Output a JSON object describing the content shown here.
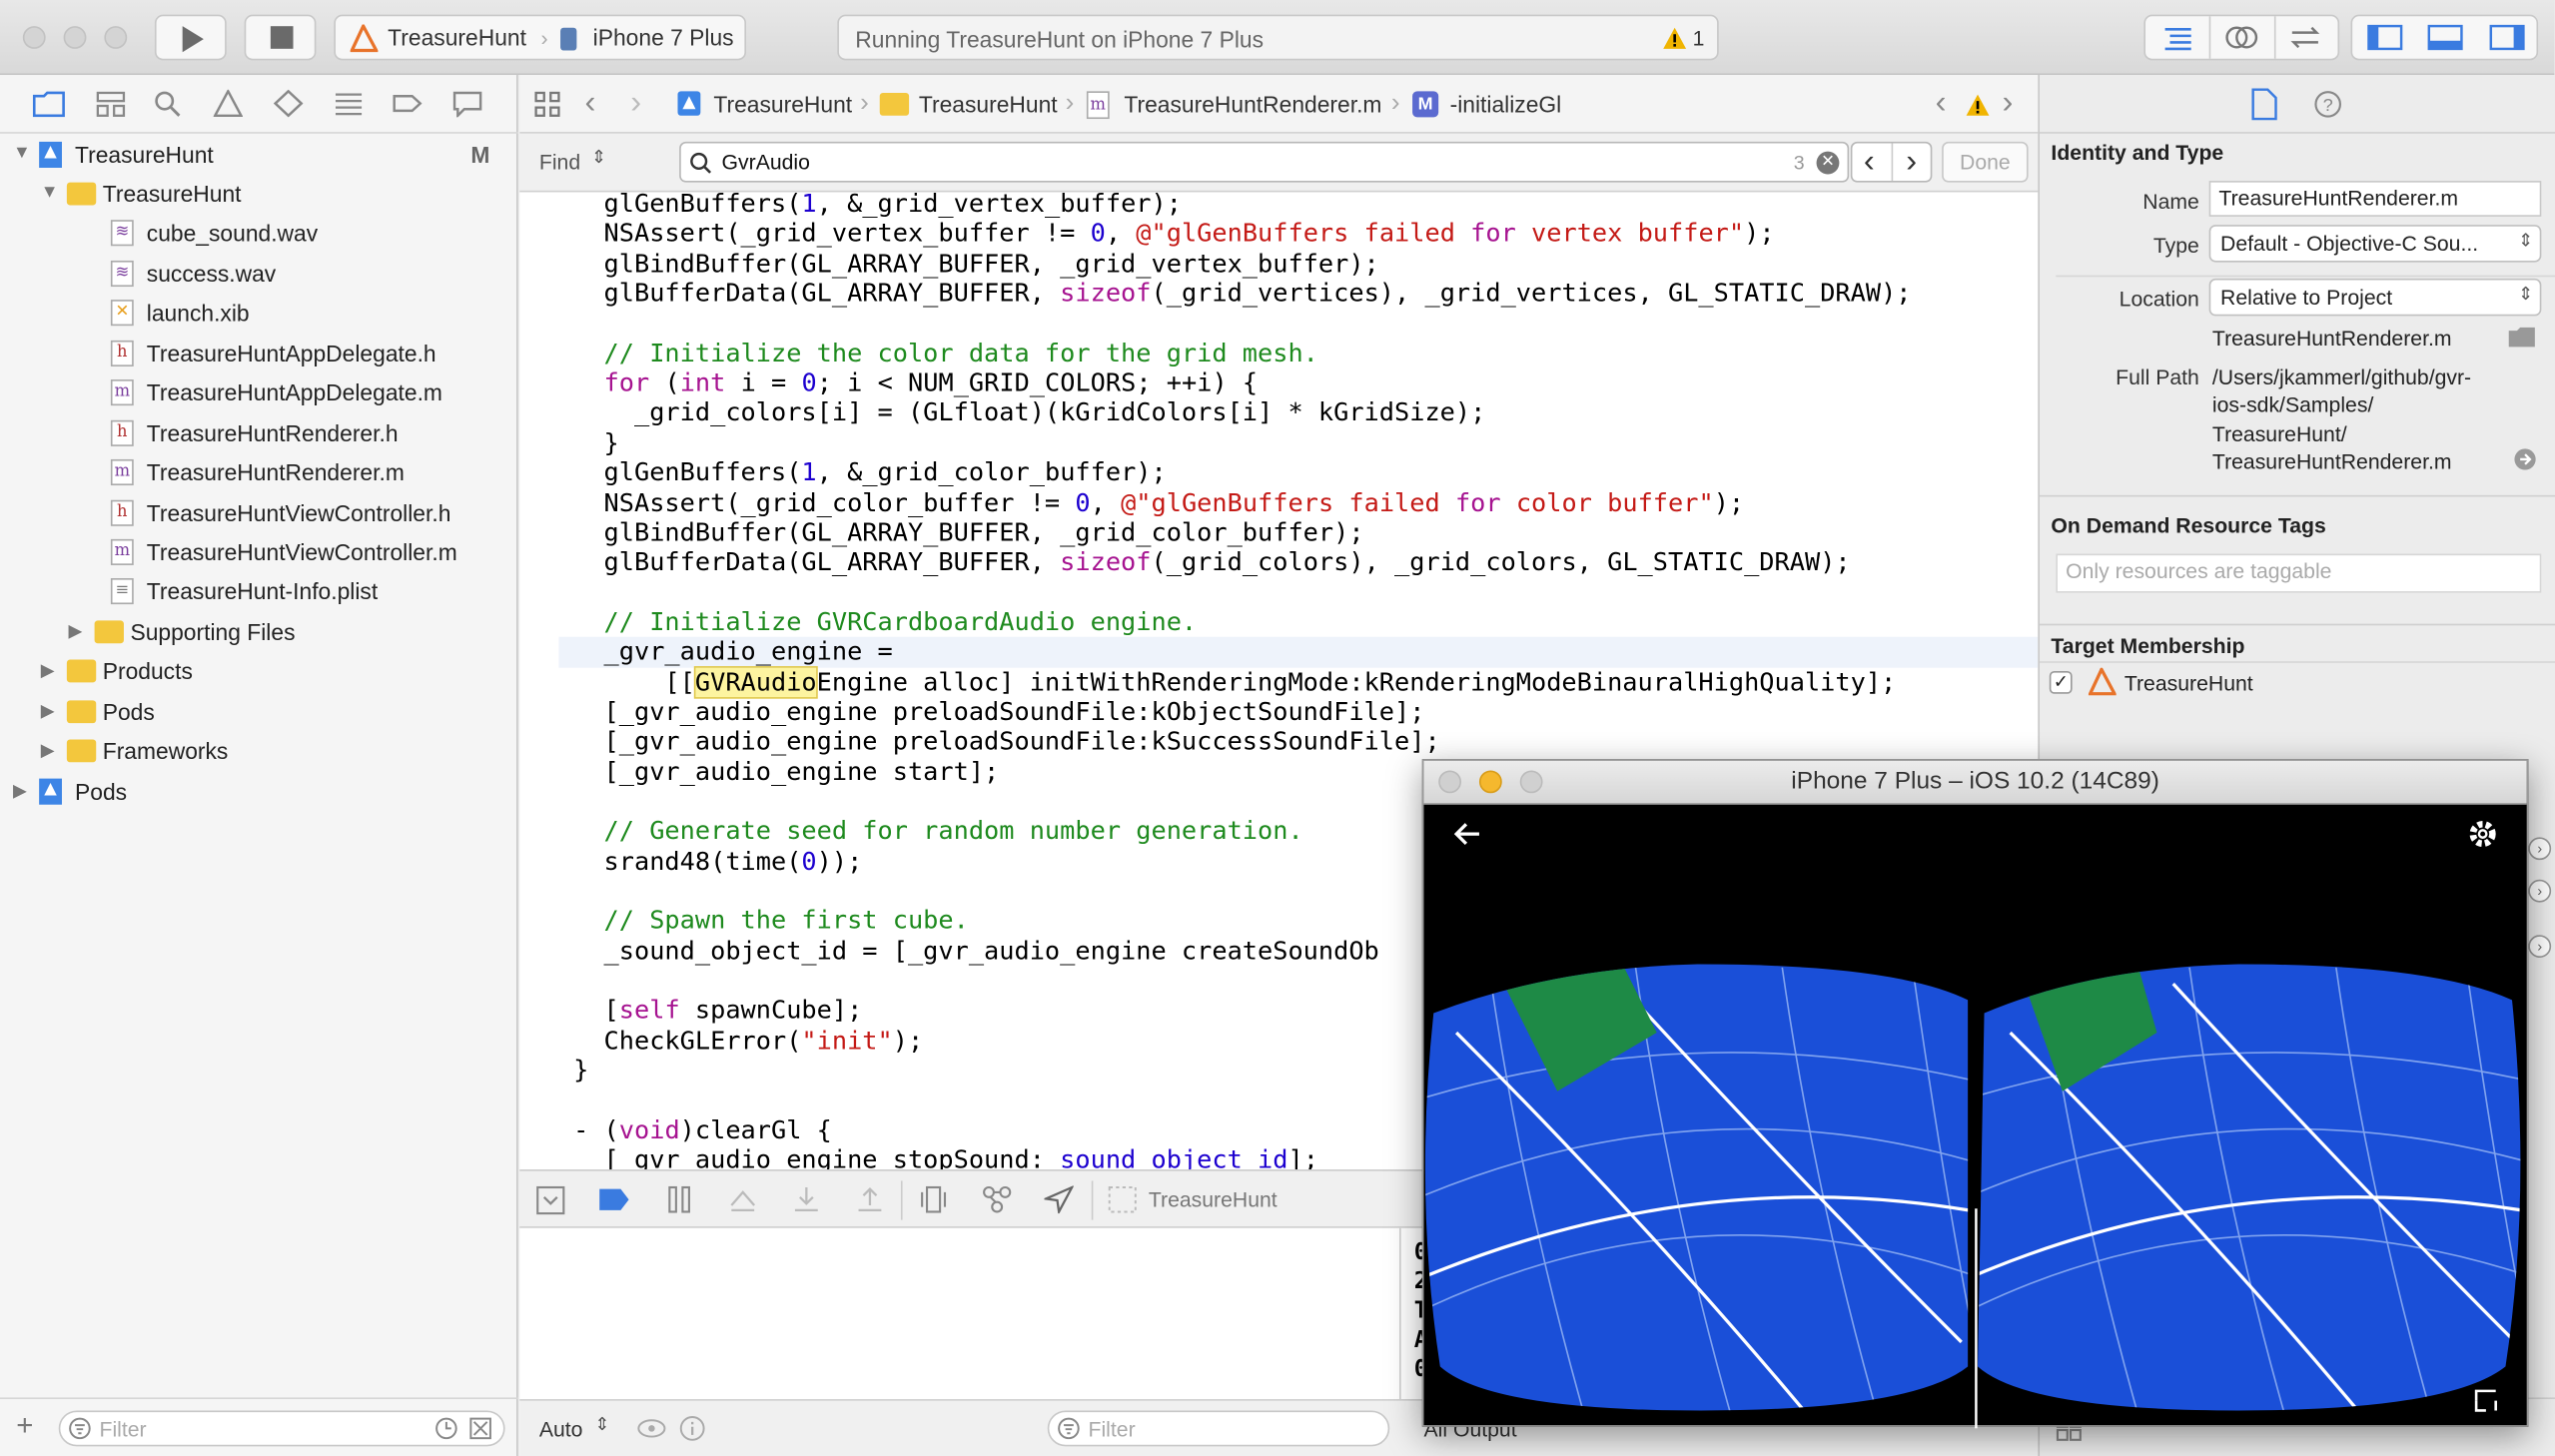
{
  "toolbar": {
    "scheme": "TreasureHunt",
    "device": "iPhone 7 Plus",
    "status": "Running TreasureHunt on iPhone 7 Plus",
    "warning_count": "1"
  },
  "navigator": {
    "items": [
      {
        "label": "TreasureHunt",
        "badge": "M"
      },
      {
        "label": "TreasureHunt"
      },
      {
        "label": "cube_sound.wav"
      },
      {
        "label": "success.wav"
      },
      {
        "label": "launch.xib"
      },
      {
        "label": "TreasureHuntAppDelegate.h"
      },
      {
        "label": "TreasureHuntAppDelegate.m"
      },
      {
        "label": "TreasureHuntRenderer.h"
      },
      {
        "label": "TreasureHuntRenderer.m"
      },
      {
        "label": "TreasureHuntViewController.h"
      },
      {
        "label": "TreasureHuntViewController.m"
      },
      {
        "label": "TreasureHunt-Info.plist"
      },
      {
        "label": "Supporting Files"
      },
      {
        "label": "Products"
      },
      {
        "label": "Pods"
      },
      {
        "label": "Frameworks"
      },
      {
        "label": "Pods"
      }
    ],
    "filter_placeholder": "Filter"
  },
  "jumpbar": {
    "crumbs": [
      "TreasureHunt",
      "TreasureHunt",
      "TreasureHuntRenderer.m",
      "-initializeGl"
    ]
  },
  "find": {
    "mode": "Find",
    "query": "GvrAudio",
    "count": "3",
    "done": "Done"
  },
  "code_lines": [
    "  glGenBuffers(1, &_grid_vertex_buffer);",
    "  NSAssert(_grid_vertex_buffer != 0, @\"glGenBuffers failed for vertex buffer\");",
    "  glBindBuffer(GL_ARRAY_BUFFER, _grid_vertex_buffer);",
    "  glBufferData(GL_ARRAY_BUFFER, sizeof(_grid_vertices), _grid_vertices, GL_STATIC_DRAW);",
    "",
    "  // Initialize the color data for the grid mesh.",
    "  for (int i = 0; i < NUM_GRID_COLORS; ++i) {",
    "    _grid_colors[i] = (GLfloat)(kGridColors[i] * kGridSize);",
    "  }",
    "  glGenBuffers(1, &_grid_color_buffer);",
    "  NSAssert(_grid_color_buffer != 0, @\"glGenBuffers failed for color buffer\");",
    "  glBindBuffer(GL_ARRAY_BUFFER, _grid_color_buffer);",
    "  glBufferData(GL_ARRAY_BUFFER, sizeof(_grid_colors), _grid_colors, GL_STATIC_DRAW);",
    "",
    "  // Initialize GVRCardboardAudio engine.",
    "  _gvr_audio_engine =",
    "      [[GVRAudioEngine alloc] initWithRenderingMode:kRenderingModeBinauralHighQuality];",
    "  [_gvr_audio_engine preloadSoundFile:kObjectSoundFile];",
    "  [_gvr_audio_engine preloadSoundFile:kSuccessSoundFile];",
    "  [_gvr_audio_engine start];",
    "",
    "  // Generate seed for random number generation.",
    "  srand48(time(0));",
    "",
    "  // Spawn the first cube.",
    "  _sound_object_id = [_gvr_audio_engine createSoundOb",
    "",
    "  [self spawnCube];",
    "  CheckGLError(\"init\");",
    "}",
    "",
    "- (void)clearGl {",
    "  [_gvr_audio_engine stopSound:_sound_object_id];"
  ],
  "debug": {
    "target": "TreasureHunt",
    "auto": "Auto",
    "filter_placeholder": "Filter",
    "output": "All Output",
    "console_chars": [
      "0",
      "2",
      "T",
      "A",
      "0"
    ]
  },
  "inspector": {
    "section_identity": "Identity and Type",
    "name_label": "Name",
    "name_value": "TreasureHuntRenderer.m",
    "type_label": "Type",
    "type_value": "Default - Objective-C Sou...",
    "location_label": "Location",
    "location_value": "Relative to Project",
    "location_file": "TreasureHuntRenderer.m",
    "fullpath_label": "Full Path",
    "fullpath_lines": [
      "/Users/jkammerl/github/gvr-",
      "ios-sdk/Samples/",
      "TreasureHunt/",
      "TreasureHuntRenderer.m"
    ],
    "section_tags": "On Demand Resource Tags",
    "tags_placeholder": "Only resources are taggable",
    "section_target": "Target Membership",
    "target_name": "TreasureHunt"
  },
  "simulator": {
    "title": "iPhone 7 Plus – iOS 10.2 (14C89)",
    "sky_color": "#1a4fd8",
    "cube_color": "#1e8a46",
    "edge_color": "#d42a2a"
  }
}
